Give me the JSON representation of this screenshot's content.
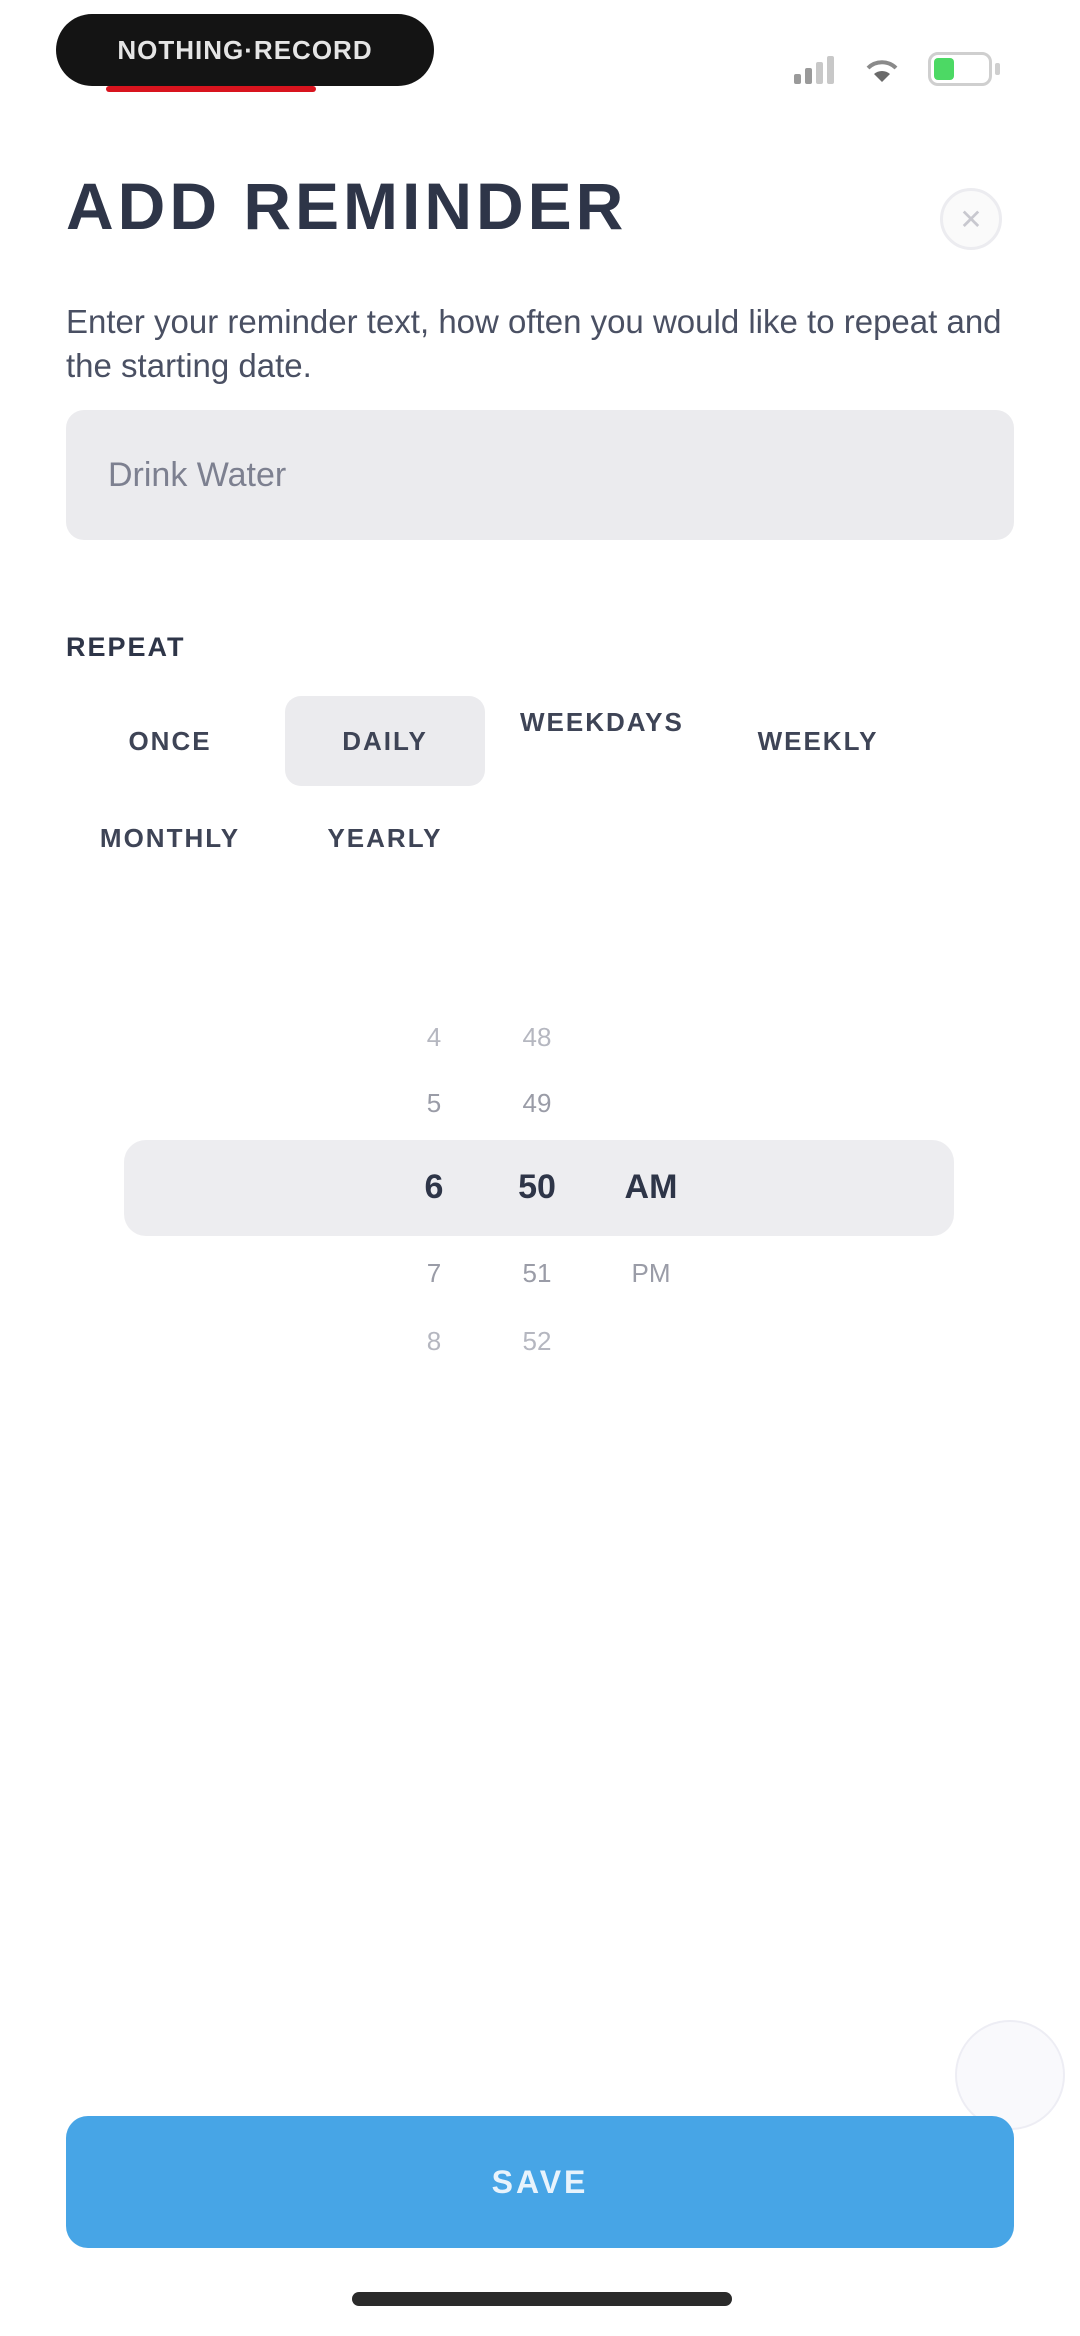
{
  "status_bar": {
    "recording_label": "NOTHING·RECORD"
  },
  "header": {
    "title": "ADD REMINDER",
    "close_icon": "close-icon"
  },
  "description": "Enter your reminder text, how often you would like to repeat and the starting date.",
  "reminder_input": {
    "value": "",
    "placeholder": "Drink Water"
  },
  "repeat": {
    "label": "REPEAT",
    "options": [
      {
        "label": "ONCE",
        "selected": false
      },
      {
        "label": "DAILY",
        "selected": true
      },
      {
        "label": "WEEKDAYS",
        "selected": false
      },
      {
        "label": "WEEKLY",
        "selected": false
      },
      {
        "label": "MONTHLY",
        "selected": false
      },
      {
        "label": "YEARLY",
        "selected": false
      }
    ]
  },
  "time_picker": {
    "hours": [
      "4",
      "5",
      "6",
      "7",
      "8"
    ],
    "minutes": [
      "48",
      "49",
      "50",
      "51",
      "52"
    ],
    "periods": [
      "AM",
      "PM"
    ],
    "selected": {
      "hour": "6",
      "minute": "50",
      "period": "AM"
    }
  },
  "save_button": {
    "label": "SAVE"
  }
}
